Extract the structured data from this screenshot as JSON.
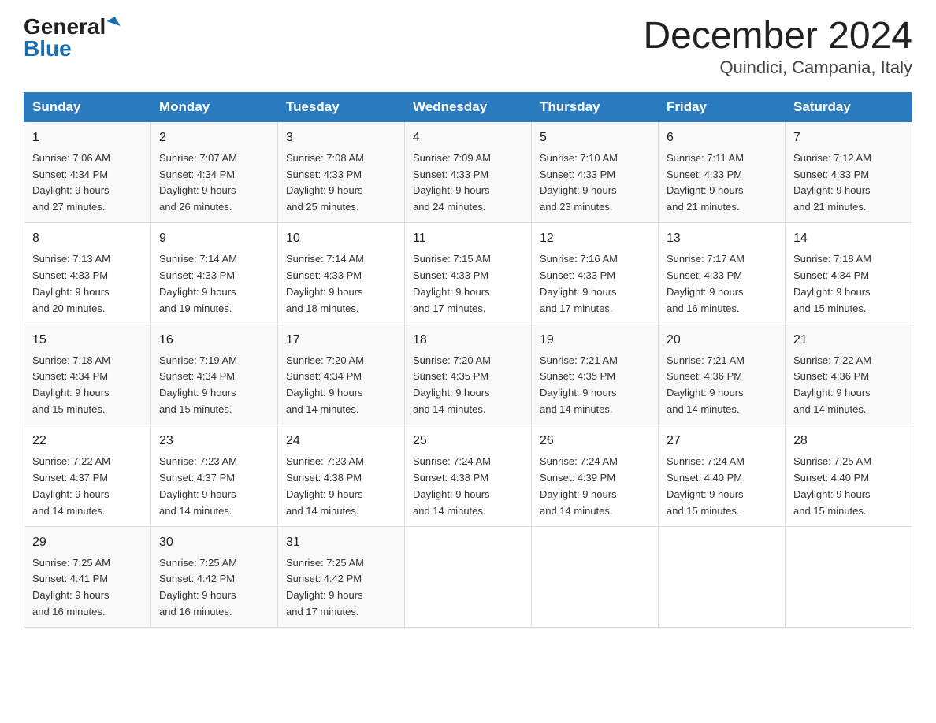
{
  "logo": {
    "general": "General",
    "blue": "Blue"
  },
  "title": "December 2024",
  "location": "Quindici, Campania, Italy",
  "days_of_week": [
    "Sunday",
    "Monday",
    "Tuesday",
    "Wednesday",
    "Thursday",
    "Friday",
    "Saturday"
  ],
  "weeks": [
    [
      {
        "day": "1",
        "sunrise": "7:06 AM",
        "sunset": "4:34 PM",
        "daylight": "9 hours and 27 minutes."
      },
      {
        "day": "2",
        "sunrise": "7:07 AM",
        "sunset": "4:34 PM",
        "daylight": "9 hours and 26 minutes."
      },
      {
        "day": "3",
        "sunrise": "7:08 AM",
        "sunset": "4:33 PM",
        "daylight": "9 hours and 25 minutes."
      },
      {
        "day": "4",
        "sunrise": "7:09 AM",
        "sunset": "4:33 PM",
        "daylight": "9 hours and 24 minutes."
      },
      {
        "day": "5",
        "sunrise": "7:10 AM",
        "sunset": "4:33 PM",
        "daylight": "9 hours and 23 minutes."
      },
      {
        "day": "6",
        "sunrise": "7:11 AM",
        "sunset": "4:33 PM",
        "daylight": "9 hours and 21 minutes."
      },
      {
        "day": "7",
        "sunrise": "7:12 AM",
        "sunset": "4:33 PM",
        "daylight": "9 hours and 21 minutes."
      }
    ],
    [
      {
        "day": "8",
        "sunrise": "7:13 AM",
        "sunset": "4:33 PM",
        "daylight": "9 hours and 20 minutes."
      },
      {
        "day": "9",
        "sunrise": "7:14 AM",
        "sunset": "4:33 PM",
        "daylight": "9 hours and 19 minutes."
      },
      {
        "day": "10",
        "sunrise": "7:14 AM",
        "sunset": "4:33 PM",
        "daylight": "9 hours and 18 minutes."
      },
      {
        "day": "11",
        "sunrise": "7:15 AM",
        "sunset": "4:33 PM",
        "daylight": "9 hours and 17 minutes."
      },
      {
        "day": "12",
        "sunrise": "7:16 AM",
        "sunset": "4:33 PM",
        "daylight": "9 hours and 17 minutes."
      },
      {
        "day": "13",
        "sunrise": "7:17 AM",
        "sunset": "4:33 PM",
        "daylight": "9 hours and 16 minutes."
      },
      {
        "day": "14",
        "sunrise": "7:18 AM",
        "sunset": "4:34 PM",
        "daylight": "9 hours and 15 minutes."
      }
    ],
    [
      {
        "day": "15",
        "sunrise": "7:18 AM",
        "sunset": "4:34 PM",
        "daylight": "9 hours and 15 minutes."
      },
      {
        "day": "16",
        "sunrise": "7:19 AM",
        "sunset": "4:34 PM",
        "daylight": "9 hours and 15 minutes."
      },
      {
        "day": "17",
        "sunrise": "7:20 AM",
        "sunset": "4:34 PM",
        "daylight": "9 hours and 14 minutes."
      },
      {
        "day": "18",
        "sunrise": "7:20 AM",
        "sunset": "4:35 PM",
        "daylight": "9 hours and 14 minutes."
      },
      {
        "day": "19",
        "sunrise": "7:21 AM",
        "sunset": "4:35 PM",
        "daylight": "9 hours and 14 minutes."
      },
      {
        "day": "20",
        "sunrise": "7:21 AM",
        "sunset": "4:36 PM",
        "daylight": "9 hours and 14 minutes."
      },
      {
        "day": "21",
        "sunrise": "7:22 AM",
        "sunset": "4:36 PM",
        "daylight": "9 hours and 14 minutes."
      }
    ],
    [
      {
        "day": "22",
        "sunrise": "7:22 AM",
        "sunset": "4:37 PM",
        "daylight": "9 hours and 14 minutes."
      },
      {
        "day": "23",
        "sunrise": "7:23 AM",
        "sunset": "4:37 PM",
        "daylight": "9 hours and 14 minutes."
      },
      {
        "day": "24",
        "sunrise": "7:23 AM",
        "sunset": "4:38 PM",
        "daylight": "9 hours and 14 minutes."
      },
      {
        "day": "25",
        "sunrise": "7:24 AM",
        "sunset": "4:38 PM",
        "daylight": "9 hours and 14 minutes."
      },
      {
        "day": "26",
        "sunrise": "7:24 AM",
        "sunset": "4:39 PM",
        "daylight": "9 hours and 14 minutes."
      },
      {
        "day": "27",
        "sunrise": "7:24 AM",
        "sunset": "4:40 PM",
        "daylight": "9 hours and 15 minutes."
      },
      {
        "day": "28",
        "sunrise": "7:25 AM",
        "sunset": "4:40 PM",
        "daylight": "9 hours and 15 minutes."
      }
    ],
    [
      {
        "day": "29",
        "sunrise": "7:25 AM",
        "sunset": "4:41 PM",
        "daylight": "9 hours and 16 minutes."
      },
      {
        "day": "30",
        "sunrise": "7:25 AM",
        "sunset": "4:42 PM",
        "daylight": "9 hours and 16 minutes."
      },
      {
        "day": "31",
        "sunrise": "7:25 AM",
        "sunset": "4:42 PM",
        "daylight": "9 hours and 17 minutes."
      },
      null,
      null,
      null,
      null
    ]
  ],
  "labels": {
    "sunrise": "Sunrise:",
    "sunset": "Sunset:",
    "daylight": "Daylight:"
  }
}
